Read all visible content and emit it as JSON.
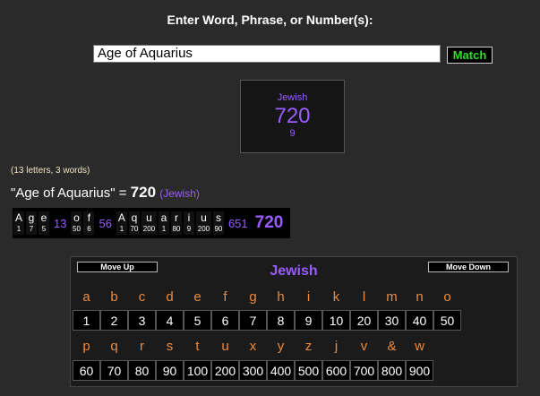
{
  "prompt": "Enter Word, Phrase, or Number(s):",
  "input_value": "Age of Aquarius",
  "match_label": "Match",
  "result_box": {
    "cipher_name": "Jewish",
    "value": "720",
    "reduced": "9"
  },
  "counts": "(13 letters, 3 words)",
  "summary": {
    "phrase": "\"Age of Aquarius\"",
    "equals": " = ",
    "value": "720",
    "cipher": "(Jewish)"
  },
  "breakdown": {
    "words": [
      {
        "letters": [
          {
            "ch": "A",
            "val": "1"
          },
          {
            "ch": "g",
            "val": "7"
          },
          {
            "ch": "e",
            "val": "5"
          }
        ],
        "sum": "13"
      },
      {
        "letters": [
          {
            "ch": "o",
            "val": "50"
          },
          {
            "ch": "f",
            "val": "6"
          }
        ],
        "sum": "56"
      },
      {
        "letters": [
          {
            "ch": "A",
            "val": "1"
          },
          {
            "ch": "q",
            "val": "70"
          },
          {
            "ch": "u",
            "val": "200"
          },
          {
            "ch": "a",
            "val": "1"
          },
          {
            "ch": "r",
            "val": "80"
          },
          {
            "ch": "i",
            "val": "9"
          },
          {
            "ch": "u",
            "val": "200"
          },
          {
            "ch": "s",
            "val": "90"
          }
        ],
        "sum": "651"
      }
    ],
    "total": "720"
  },
  "cipher_table": {
    "title": "Jewish",
    "move_up": "Move Up",
    "move_down": "Move Down",
    "row1_letters": [
      "a",
      "b",
      "c",
      "d",
      "e",
      "f",
      "g",
      "h",
      "i",
      "k",
      "l",
      "m",
      "n",
      "o"
    ],
    "row1_values": [
      "1",
      "2",
      "3",
      "4",
      "5",
      "6",
      "7",
      "8",
      "9",
      "10",
      "20",
      "30",
      "40",
      "50"
    ],
    "row2_letters": [
      "p",
      "q",
      "r",
      "s",
      "t",
      "u",
      "x",
      "y",
      "z",
      "j",
      "v",
      "&",
      "w"
    ],
    "row2_values": [
      "60",
      "70",
      "80",
      "90",
      "100",
      "200",
      "300",
      "400",
      "500",
      "600",
      "700",
      "800",
      "900"
    ]
  },
  "colors": {
    "background": "#2a2a2a",
    "purple": "#9a5cff",
    "orange": "#ee8a3a",
    "match_green": "#2ddd2d"
  }
}
